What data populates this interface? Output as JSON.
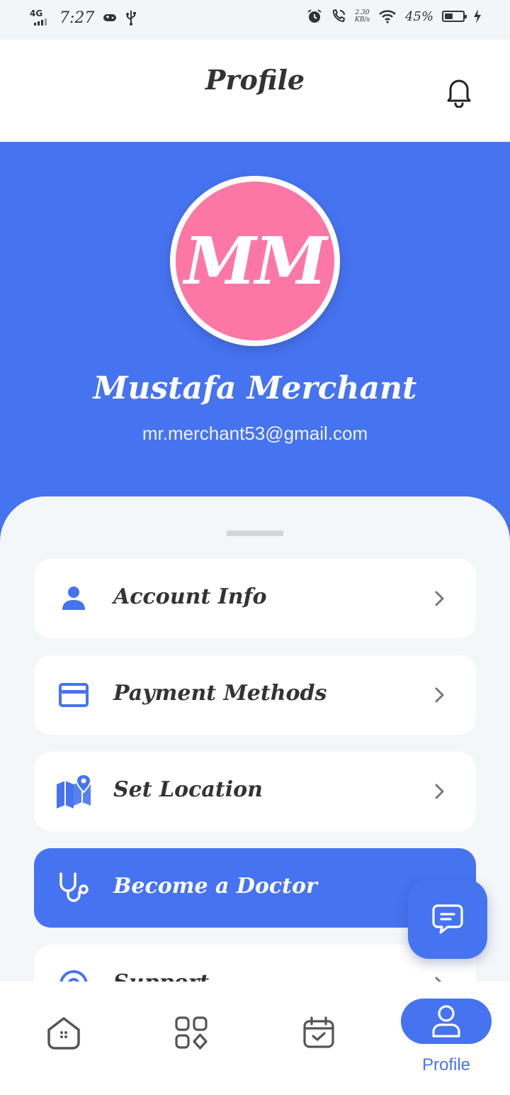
{
  "status_bar": {
    "network": "4G",
    "time": "7:27",
    "speed_value": "2.30",
    "speed_unit": "KB/s",
    "battery_percent": "45%",
    "battery_level": 0.45
  },
  "app_bar": {
    "title": "Profile"
  },
  "profile": {
    "initials": "MM",
    "name": "Mustafa Merchant",
    "email": "mr.merchant53@gmail.com"
  },
  "colors": {
    "accent": "#4673f0",
    "avatar_bg": "#fd77a4",
    "text_dark": "#333333",
    "sheet_bg": "#f4f7fa"
  },
  "menu": [
    {
      "label": "Account Info",
      "icon": "person-icon"
    },
    {
      "label": "Payment Methods",
      "icon": "credit-card-icon"
    },
    {
      "label": "Set Location",
      "icon": "map-pin-icon"
    },
    {
      "label": "Become a Doctor",
      "icon": "stethoscope-icon"
    },
    {
      "label": "Support",
      "icon": "support-icon"
    }
  ],
  "bottom_nav": {
    "items": [
      {
        "icon": "home-icon"
      },
      {
        "icon": "categories-icon"
      },
      {
        "icon": "calendar-icon"
      },
      {
        "icon": "profile-icon",
        "label": "Profile",
        "active": true
      }
    ]
  }
}
